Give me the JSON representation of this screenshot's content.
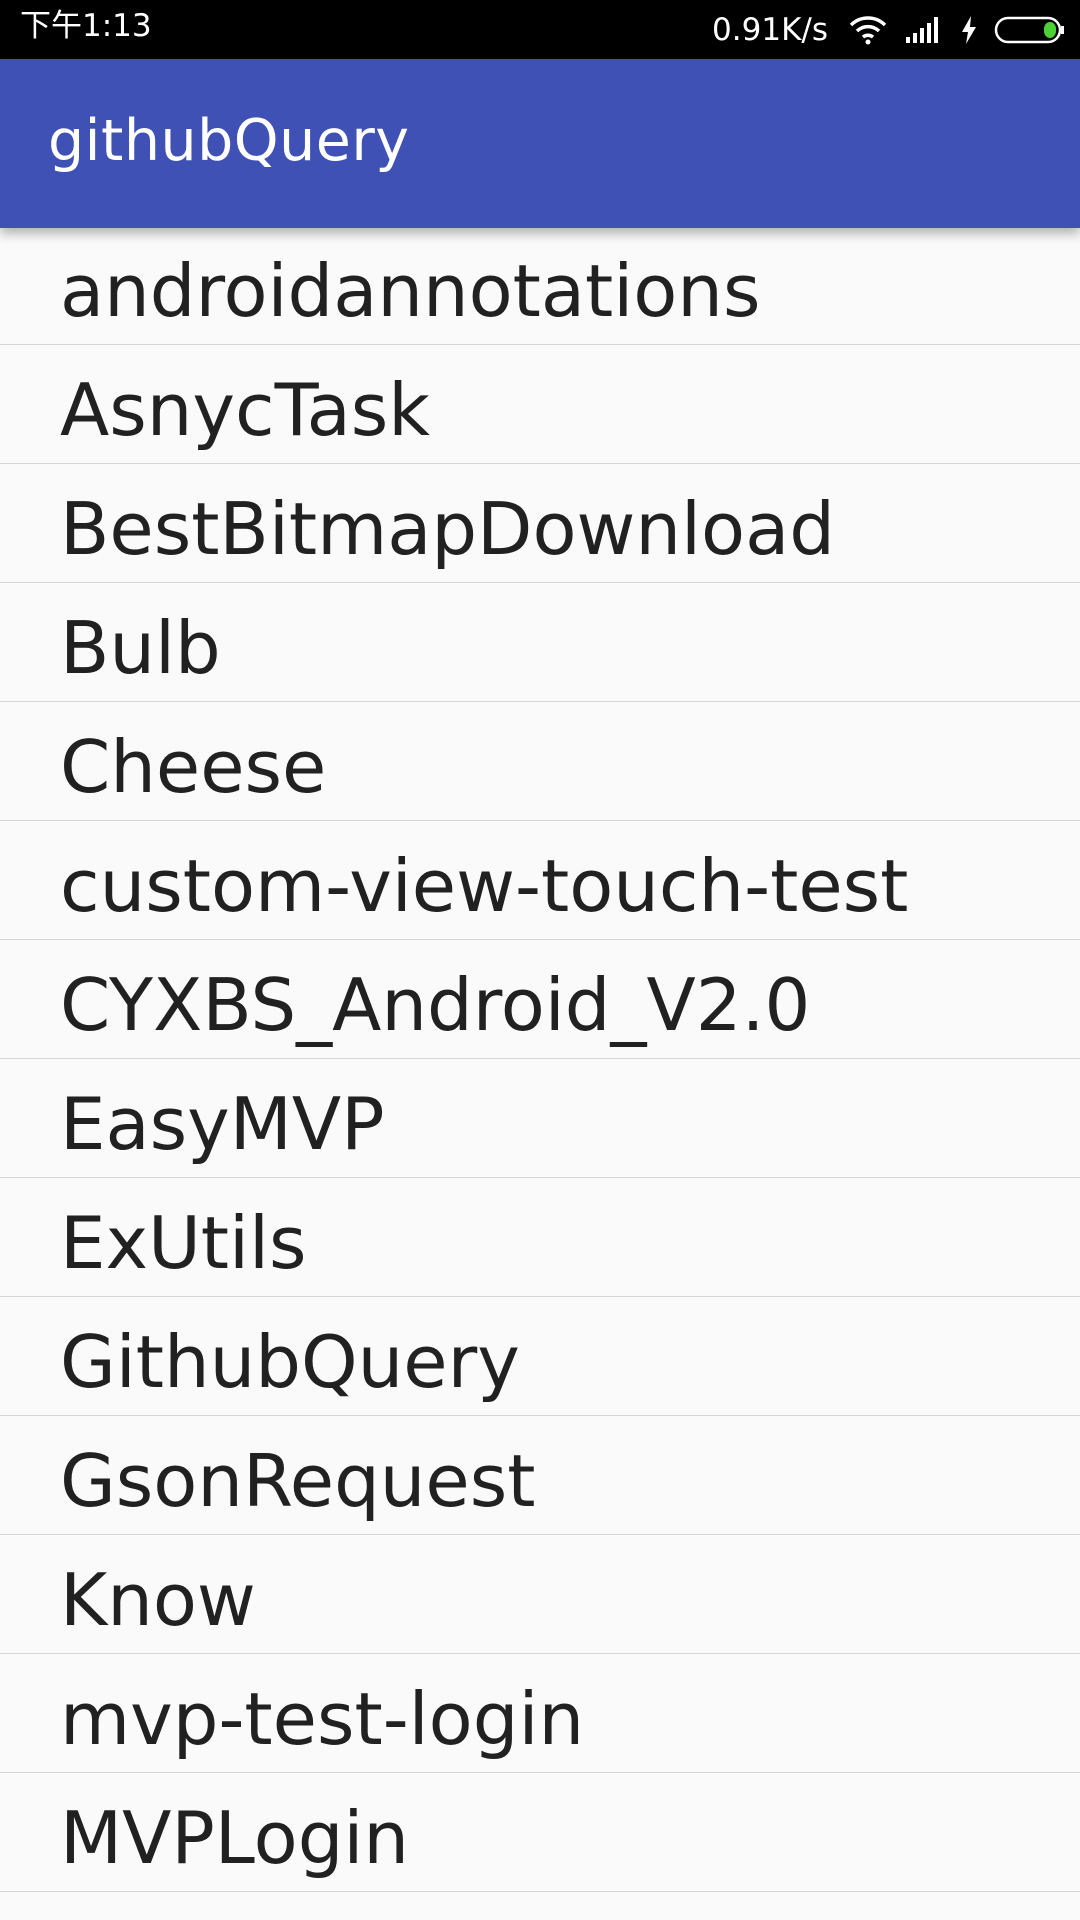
{
  "status_bar": {
    "time": "下午1:13",
    "net_speed": "0.91K/s",
    "icons": [
      "wifi-icon",
      "signal-icon",
      "charging-icon",
      "battery-icon"
    ],
    "battery_color": "#4cd137"
  },
  "app_bar": {
    "title": "githubQuery",
    "color": "#3f51b5"
  },
  "repos": [
    "androidannotations",
    "AsnycTask",
    "BestBitmapDownload",
    "Bulb",
    "Cheese",
    "custom-view-touch-test",
    "CYXBS_Android_V2.0",
    "EasyMVP",
    "ExUtils",
    "GithubQuery",
    "GsonRequest",
    "Know",
    "mvp-test-login",
    "MVPLogin"
  ]
}
